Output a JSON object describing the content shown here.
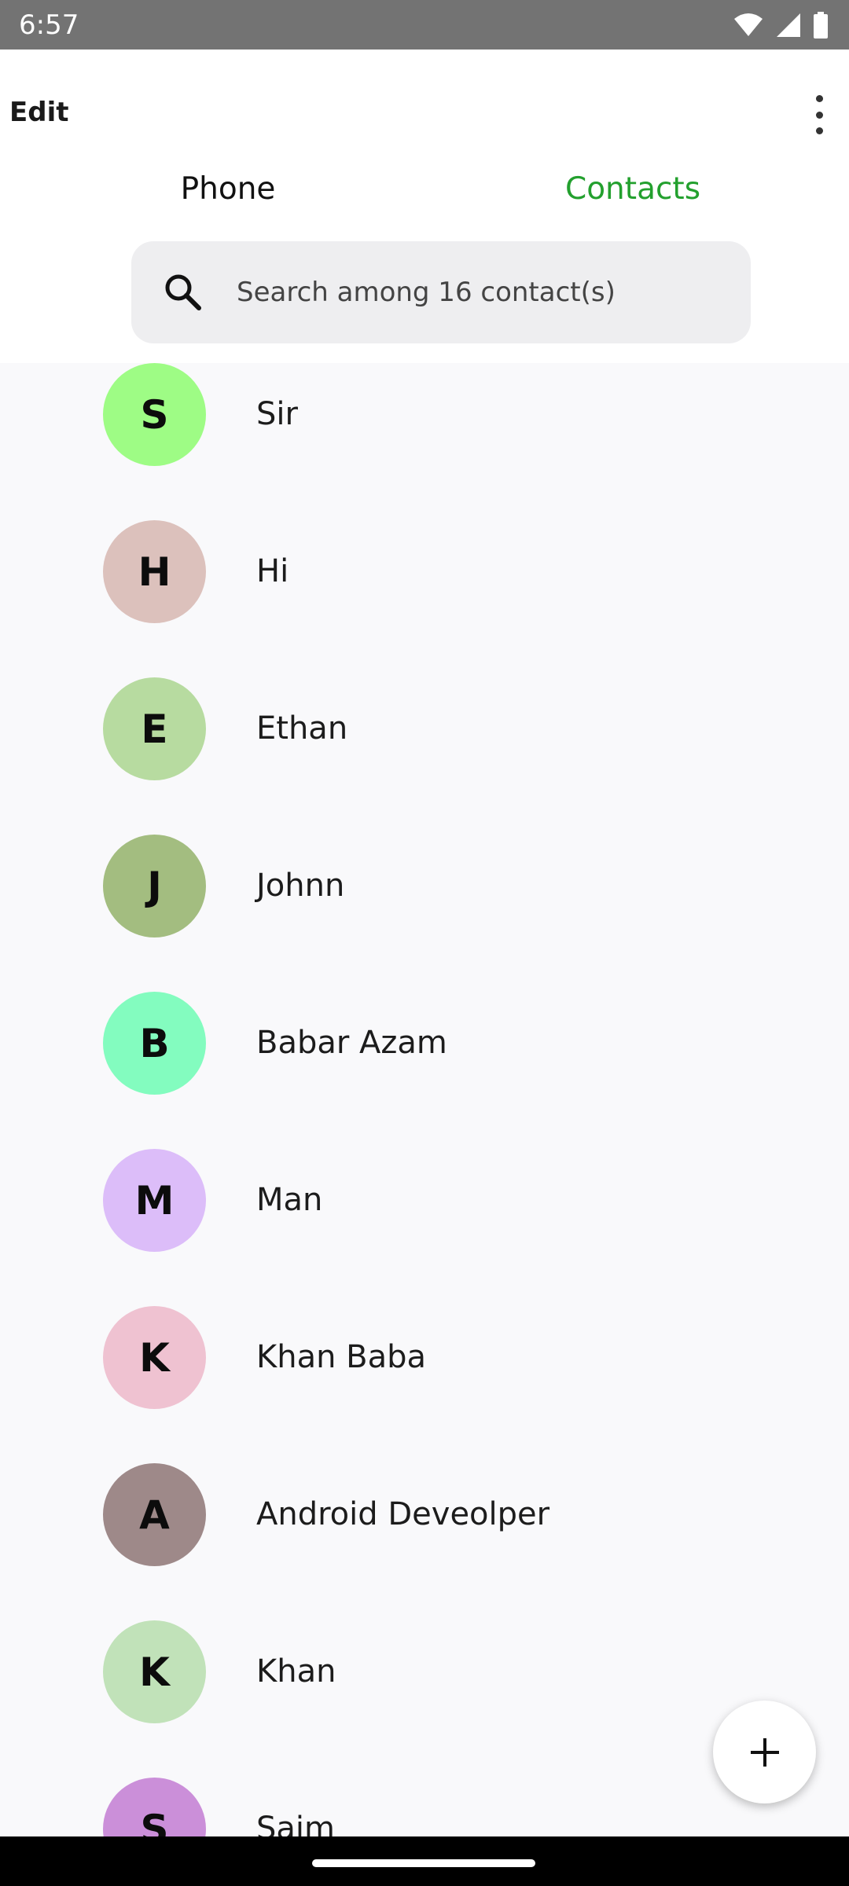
{
  "status_bar": {
    "time": "6:57"
  },
  "app_bar": {
    "edit_label": "Edit"
  },
  "tabs": [
    {
      "label": "Phone"
    },
    {
      "label": "Contacts",
      "active_color": "#23a02e"
    }
  ],
  "search": {
    "placeholder": "Search among 16 contact(s)"
  },
  "contacts": [
    {
      "initial": "S",
      "name": "Sir",
      "color": "#9efc85"
    },
    {
      "initial": "H",
      "name": "Hi",
      "color": "#dcc1bc"
    },
    {
      "initial": "E",
      "name": "Ethan",
      "color": "#b7dba0"
    },
    {
      "initial": "J",
      "name": "Johnn",
      "color": "#a3bd80"
    },
    {
      "initial": "B",
      "name": "Babar Azam",
      "color": "#83fcbf"
    },
    {
      "initial": "M",
      "name": "Man",
      "color": "#dcbdf9"
    },
    {
      "initial": "K",
      "name": "Khan Baba",
      "color": "#efc2d1"
    },
    {
      "initial": "A",
      "name": "Android Deveolper",
      "color": "#9e8989"
    },
    {
      "initial": "K",
      "name": "Khan",
      "color": "#c1e2b9"
    },
    {
      "initial": "S",
      "name": "Saim",
      "color": "#cb8fd9"
    }
  ],
  "fab": {
    "icon": "plus-icon"
  }
}
